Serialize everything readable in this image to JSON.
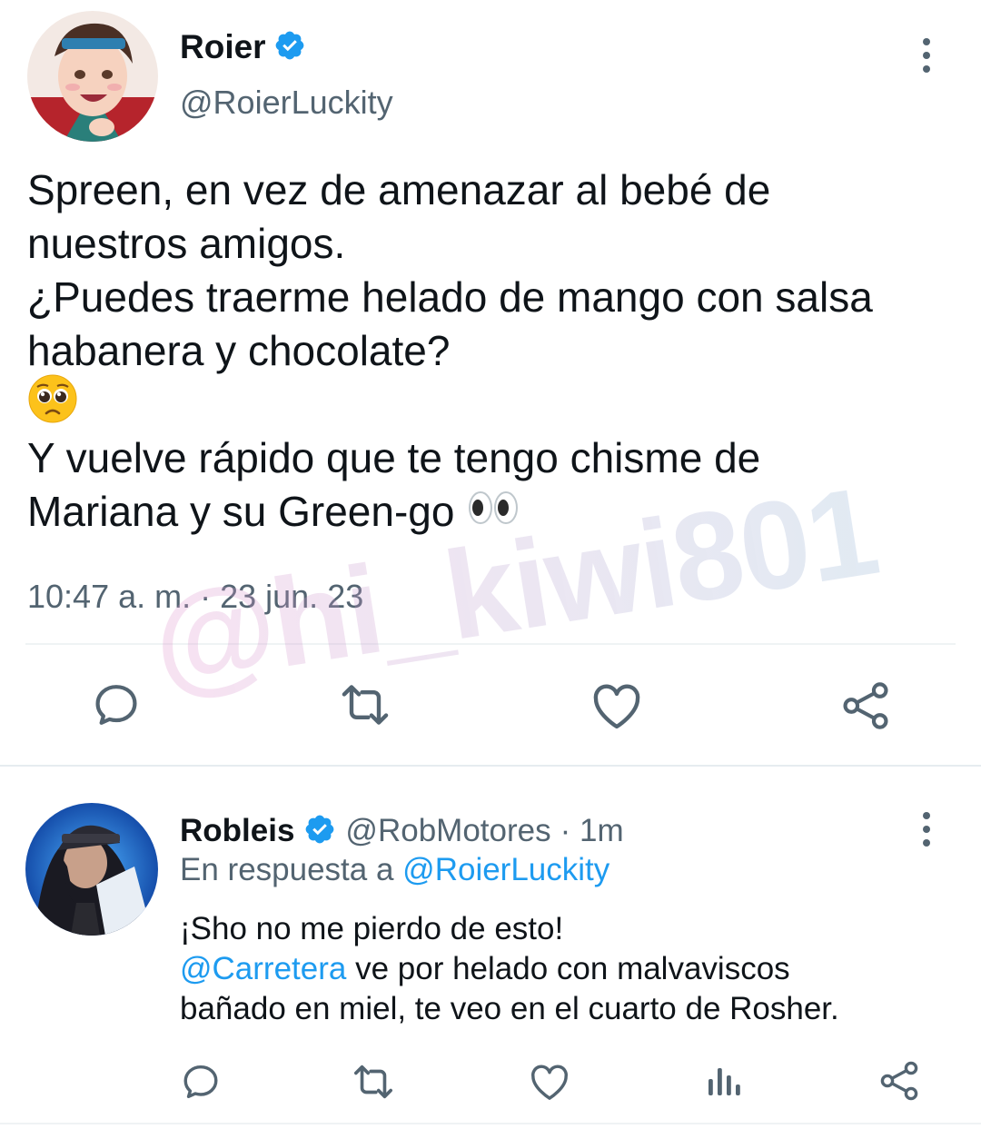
{
  "main_tweet": {
    "author_name": "Roier",
    "handle": "@RoierLuckity",
    "text_line1": "Spreen, en vez de amenazar al bebé de",
    "text_line2": "nuestros amigos.",
    "text_line3": "¿Puedes traerme helado de mango con salsa",
    "text_line4": "habanera y chocolate?",
    "text_line5": "Y vuelve rápido que te tengo chisme de",
    "text_line6": "Mariana y su Green-go",
    "timestamp": "10:47 a. m. · 23 jun. 23"
  },
  "reply": {
    "author_name": "Robleis",
    "handle": "@RobMotores",
    "time": "· 1m",
    "reply_prefix": "En respuesta a",
    "reply_to": "@RoierLuckity",
    "text_line1": "¡Sho no me pierdo de esto!",
    "mention": "@Carretera",
    "text_line2_rest": " ve por helado con malvaviscos",
    "text_line3": "bañado en miel, te veo en el cuarto de Rosher."
  },
  "watermark": "@hi_kiwi801",
  "colors": {
    "verified": "#1d9bf0",
    "link": "#1d9bf0",
    "muted": "#536471",
    "divider": "#eff3f4"
  },
  "icons": {
    "verified": "verified-badge-icon",
    "reply": "reply-icon",
    "retweet": "retweet-icon",
    "like": "heart-icon",
    "share": "share-icon",
    "views": "views-icon",
    "more": "more-options-icon",
    "pleading_face": "pleading-face-emoji",
    "eyes": "eyes-emoji"
  }
}
